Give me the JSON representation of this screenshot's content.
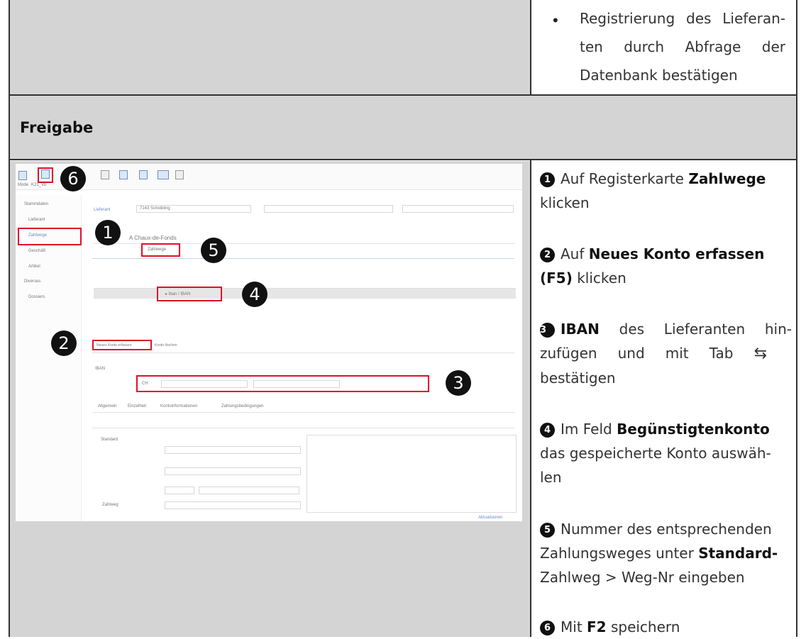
{
  "top_right_bullet": {
    "line1": "Registrierung des Lieferan-",
    "line2": "ten durch Abfrage der",
    "line3": "Datenbank bestätigen"
  },
  "section_title": "Freigabe",
  "steps": [
    {
      "num": "1",
      "pre": "Auf Registerkarte ",
      "bold": "Zahlwege",
      "line2": "klicken"
    },
    {
      "num": "2",
      "pre": "Auf ",
      "bold": "Neues Konto erfassen",
      "bold2": "(F5)",
      "line2_rest": " klicken"
    },
    {
      "num": "3",
      "bold": "IBAN",
      "rest": " des Lieferanten hin-",
      "line2": "zufügen und mit Tab",
      "line3": "bestätigen"
    },
    {
      "num": "4",
      "pre": "Im Feld ",
      "bold": "Begünstigtenkonto",
      "line2": "das gespeicherte Konto auswäh-",
      "line3": "len"
    },
    {
      "num": "5",
      "line1": "Nummer des entsprechenden",
      "line2_pre": "Zahlungsweges unter ",
      "line2_bold": "Standard-",
      "line3": "Zahlweg > Weg-Nr eingeben"
    },
    {
      "num": "6",
      "pre": "Mit ",
      "bold": "F2",
      "rest": " speichern"
    }
  ],
  "tab_arrows": "⇆",
  "screenshot": {
    "badges": [
      "6",
      "1",
      "5",
      "4",
      "2",
      "3"
    ],
    "toolbar_label": "Mode",
    "toolbar_sublabel": "K21_VE",
    "sidebar": [
      "Stammdaten",
      "Lieferant",
      "Zahlwege",
      "Geschäft",
      "Artikel",
      "Diverses",
      "Dossiers"
    ],
    "header_label": "Lieferant",
    "header_value": "7143 Scheibling",
    "company_line": "A Chaux-de-Fonds",
    "tab_zahlwege": "Zahlwege",
    "grid_cell": "▸ Iban / IBAN",
    "new_account_btn": "Neues Konto erfassen",
    "delete_btn": "Konto löschen",
    "iban_label": "IBAN",
    "iban_value": "CH",
    "detail_tabs": [
      "Allgemein",
      "Einzelheit",
      "Kontoinformationen",
      "Zahlungsbedingungen"
    ],
    "standard_label": "Standard",
    "zahlweg_label": "Zahlweg",
    "footer_link": "Aktualisieren"
  }
}
